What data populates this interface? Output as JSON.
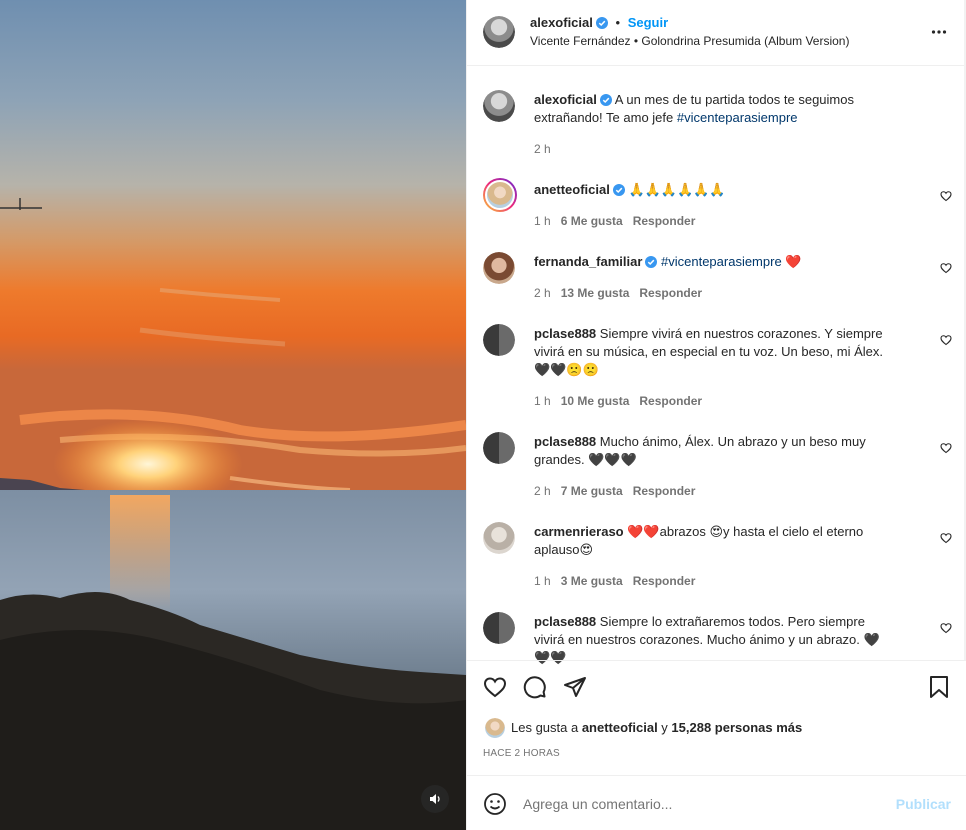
{
  "post": {
    "author": {
      "username": "alexoficial",
      "follow_label": "Seguir",
      "separator": "•",
      "audio": "Vicente Fernández • Golondrina Presumida (Album Version)"
    },
    "caption": {
      "username": "alexoficial",
      "text_before": "A un mes de tu partida todos te seguimos extrañando! Te amo jefe ",
      "hashtag": "#vicenteparasiempre",
      "time": "2 h"
    },
    "comments": [
      {
        "username": "anetteoficial",
        "verified": true,
        "text": "🙏🙏🙏🙏🙏🙏",
        "time": "1 h",
        "likes": "6 Me gusta",
        "reply": "Responder"
      },
      {
        "username": "fernanda_familiar",
        "verified": true,
        "text": "#vicenteparasiempre ❤️",
        "time": "2 h",
        "likes": "13 Me gusta",
        "reply": "Responder"
      },
      {
        "username": "pclase888",
        "verified": false,
        "text": "Siempre vivirá en nuestros corazones. Y siempre vivirá en su música, en especial en tu voz. Un beso, mi Álex. 🖤🖤🙁🙁",
        "time": "1 h",
        "likes": "10 Me gusta",
        "reply": "Responder"
      },
      {
        "username": "pclase888",
        "verified": false,
        "text": "Mucho ánimo, Álex. Un abrazo y un beso muy grandes. 🖤🖤🖤",
        "time": "2 h",
        "likes": "7 Me gusta",
        "reply": "Responder"
      },
      {
        "username": "carmenrieraso",
        "verified": false,
        "text": "❤️❤️abrazos 😍y hasta el cielo el eterno aplauso😍",
        "time": "1 h",
        "likes": "3 Me gusta",
        "reply": "Responder"
      },
      {
        "username": "pclase888",
        "verified": false,
        "text": "Siempre lo extrañaremos todos. Pero siempre vivirá en nuestros corazones. Mucho ánimo y un abrazo. 🖤🖤🖤",
        "time": "",
        "likes": "",
        "reply": ""
      }
    ],
    "likes": {
      "prefix": "Les gusta a ",
      "first_user": "anetteoficial",
      "middle": " y ",
      "others": "15,288 personas más"
    },
    "timestamp": "HACE 2 HORAS",
    "comment_input": {
      "placeholder": "Agrega un comentario...",
      "submit_label": "Publicar"
    }
  },
  "colors": {
    "verified": "#3897f0",
    "link": "#00376b",
    "accent": "#0095f6",
    "muted": "#737373",
    "publish_disabled": "#b2dffc"
  },
  "icons": [
    "more-icon",
    "verified-icon",
    "heart-icon",
    "comment-icon",
    "share-icon",
    "bookmark-icon",
    "emoji-icon",
    "audio-icon"
  ]
}
